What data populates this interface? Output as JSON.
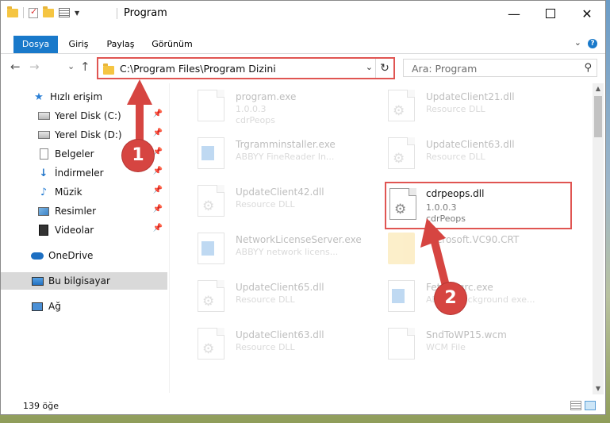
{
  "window": {
    "title": "Program",
    "minimize": "—",
    "close": "✕"
  },
  "ribbon": {
    "tabs": [
      {
        "label": "Dosya",
        "active": true
      },
      {
        "label": "Giriş"
      },
      {
        "label": "Paylaş"
      },
      {
        "label": "Görünüm"
      }
    ],
    "help": "?"
  },
  "nav": {
    "back": "←",
    "forward": "→",
    "recent": "⌄",
    "up": "↑",
    "address": "C:\\Program Files\\Program Dizini",
    "search_placeholder": "Ara: Program"
  },
  "sidebar": {
    "items": [
      {
        "label": "Hızlı erişim",
        "icon": "star-icon"
      },
      {
        "label": "Yerel Disk (C:)",
        "icon": "drive-icon",
        "pinned": true
      },
      {
        "label": "Yerel Disk (D:)",
        "icon": "drive-icon",
        "pinned": true
      },
      {
        "label": "Belgeler",
        "icon": "document-icon",
        "pinned": true
      },
      {
        "label": "İndirmeler",
        "icon": "download-icon",
        "pinned": true
      },
      {
        "label": "Müzik",
        "icon": "music-icon",
        "pinned": true
      },
      {
        "label": "Resimler",
        "icon": "pictures-icon",
        "pinned": true
      },
      {
        "label": "Videolar",
        "icon": "videos-icon",
        "pinned": true
      },
      {
        "label": "OneDrive",
        "icon": "cloud-icon"
      },
      {
        "label": "Bu bilgisayar",
        "icon": "computer-icon",
        "selected": true
      },
      {
        "label": "Ağ",
        "icon": "network-icon"
      }
    ]
  },
  "files": [
    {
      "name": "program.exe",
      "line2": "1.0.0.3",
      "line3": "cdrPeops",
      "icon": "program-icon"
    },
    {
      "name": "UpdateClient21.dll",
      "line2": "Resource DLL",
      "line3": "",
      "icon": "dll-icon"
    },
    {
      "name": "Trgramminstaller.exe",
      "line2": "ABBYY FineReader In...",
      "line3": "",
      "icon": "exe-icon"
    },
    {
      "name": "UpdateClient63.dll",
      "line2": "Resource DLL",
      "line3": "",
      "icon": "dll-icon"
    },
    {
      "name": "UpdateClient42.dll",
      "line2": "Resource DLL",
      "line3": "",
      "icon": "dll-icon"
    },
    {
      "name": "cdrpeops.dll",
      "line2": "1.0.0.3",
      "line3": "cdrPeops",
      "icon": "dll-icon",
      "highlighted": true
    },
    {
      "name": "NetworkLicenseServer.exe",
      "line2": "ABBYY network licens...",
      "line3": "",
      "icon": "exe-icon"
    },
    {
      "name": "Microsoft.VC90.CRT",
      "line2": "",
      "line3": "",
      "icon": "folder-icon"
    },
    {
      "name": "UpdateClient65.dll",
      "line2": "Resource DLL",
      "line3": "",
      "icon": "dll-icon"
    },
    {
      "name": "FetchBgrc.exe",
      "line2": "ABBYY background exe...",
      "line3": "",
      "icon": "exe-icon"
    },
    {
      "name": "UpdateClient63.dll",
      "line2": "Resource DLL",
      "line3": "",
      "icon": "dll-icon"
    },
    {
      "name": "SndToWP15.wcm",
      "line2": "WCM File",
      "line3": "",
      "icon": "dll-icon"
    }
  ],
  "status": {
    "count": "139 öğe"
  },
  "annotations": {
    "step1": "1",
    "step2": "2",
    "color": "#d64541"
  }
}
